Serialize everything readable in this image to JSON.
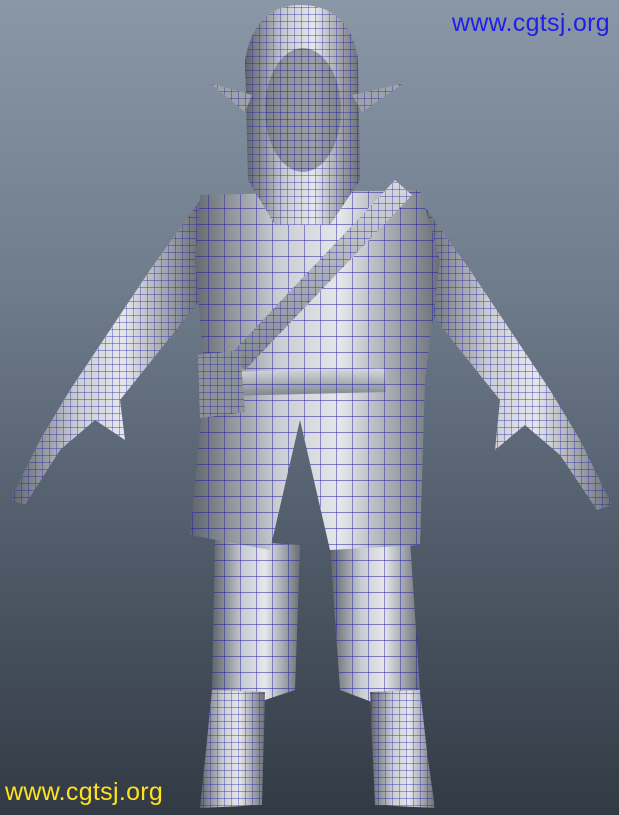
{
  "watermark": {
    "top": "www.cgtsj.org",
    "bottom": "www.cgtsj.org",
    "top_color": "#1f1fe6",
    "bottom_color": "#ffe21e"
  },
  "viewport": {
    "background_top": "#8a97a6",
    "background_bottom": "#323a44",
    "wireframe_color": "#10109a",
    "shaded_color": "#b9bcc2"
  }
}
